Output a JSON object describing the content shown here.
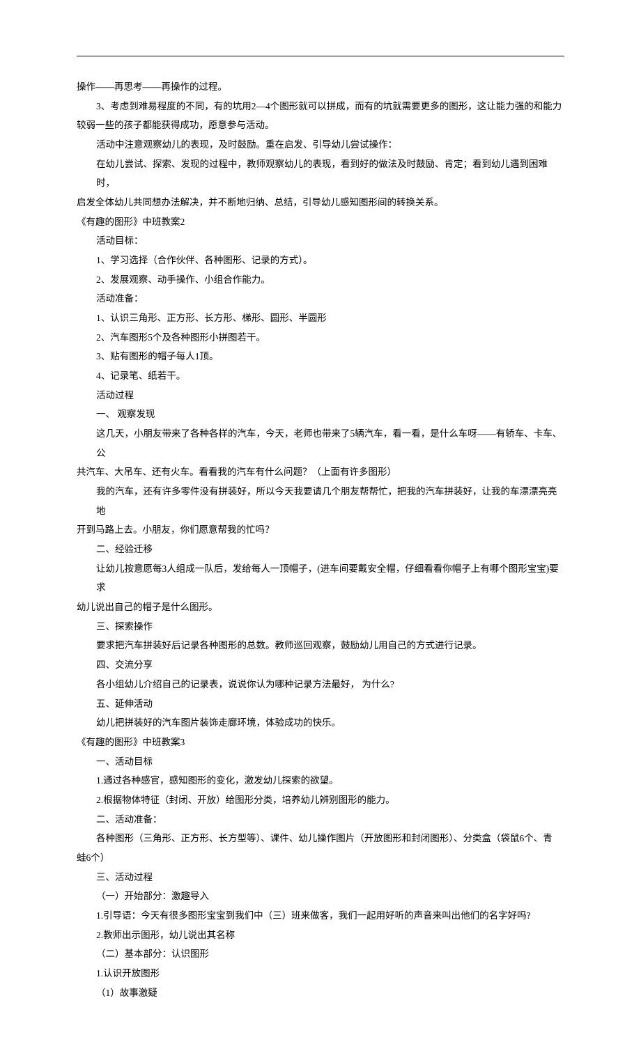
{
  "lines": [
    {
      "cls": "line",
      "text": "操作——再思考——再操作的过程。"
    },
    {
      "cls": "line indent1",
      "text": "3、考虑到难易程度的不同，有的坑用2—4个图形就可以拼成，而有的坑就需要更多的图形，这让能力强的和能力"
    },
    {
      "cls": "line",
      "text": "较弱一些的孩子都能获得成功，愿意参与活动。"
    },
    {
      "cls": "line indent1",
      "text": "活动中注意观察幼儿的表现，及时鼓励。重在启发、引导幼儿尝试操作："
    },
    {
      "cls": "line indent1",
      "text": "在幼儿尝试、探索、发现的过程中，教师观察幼儿的表现，看到好的做法及时鼓励、肯定；看到幼儿遇到困难时，"
    },
    {
      "cls": "line",
      "text": "启发全体幼儿共同想办法解决，并不断地归纳、总结，引导幼儿感知图形间的转换关系。"
    },
    {
      "cls": "line heading",
      "text": "《有趣的图形》中班教案2"
    },
    {
      "cls": "line indent1",
      "text": "活动目标："
    },
    {
      "cls": "line indent1",
      "text": "1、学习选择（合作伙伴、各种图形、记录的方式）。"
    },
    {
      "cls": "line indent1",
      "text": "2、发展观察、动手操作、小组合作能力。"
    },
    {
      "cls": "line indent1",
      "text": "活动准备："
    },
    {
      "cls": "line indent1",
      "text": "1、认识三角形、正方形、长方形、梯形、圆形、半圆形"
    },
    {
      "cls": "line indent1",
      "text": "2、汽车图形5个及各种图形小拼图若干。"
    },
    {
      "cls": "line indent1",
      "text": "3、贴有图形的帽子每人1顶。"
    },
    {
      "cls": "line indent1",
      "text": "4、记录笔、纸若干。"
    },
    {
      "cls": "line indent1",
      "text": "活动过程"
    },
    {
      "cls": "line indent1",
      "text": "一、 观察发现"
    },
    {
      "cls": "line indent1",
      "text": "这几天，小朋友带来了各种各样的汽车，今天，老师也带来了5辆汽车，看一看，是什么车呀——有轿车、卡车、公"
    },
    {
      "cls": "line",
      "text": "共汽车、大吊车、还有火车。看看我的汽车有什么问题？（上面有许多图形）"
    },
    {
      "cls": "line indent1",
      "text": "我的汽车，还有许多零件没有拼装好，所以今天我要请几个朋友帮帮忙，把我的汽车拼装好，让我的车漂漂亮亮地"
    },
    {
      "cls": "line",
      "text": "开到马路上去。小朋友，你们愿意帮我的忙吗？"
    },
    {
      "cls": "line indent1",
      "text": "二、经验迁移"
    },
    {
      "cls": "line indent1",
      "text": "让幼儿按意愿每3人组成一队后，发给每人一顶帽子，(进车间要戴安全帽，仔细看看你帽子上有哪个图形宝宝)要求"
    },
    {
      "cls": "line",
      "text": "幼儿说出自己的帽子是什么图形。"
    },
    {
      "cls": "line indent1",
      "text": "三、探索操作"
    },
    {
      "cls": "line indent1",
      "text": "要求把汽车拼装好后记录各种图形的总数。教师巡回观察，鼓励幼儿用自己的方式进行记录。"
    },
    {
      "cls": "line indent1",
      "text": "四、交流分享"
    },
    {
      "cls": "line indent1",
      "text": "各小组幼儿介绍自己的记录表，说说你认为哪种记录方法最好， 为什么?"
    },
    {
      "cls": "line indent1",
      "text": "五、延伸活动"
    },
    {
      "cls": "line indent1",
      "text": "幼儿把拼装好的汽车图片装饰走廊环境，体验成功的快乐。"
    },
    {
      "cls": "line heading",
      "text": "《有趣的图形》中班教案3"
    },
    {
      "cls": "line indent1",
      "text": "一、活动目标"
    },
    {
      "cls": "line indent1",
      "text": "1.通过各种感官，感知图形的变化，激发幼儿探索的欲望。"
    },
    {
      "cls": "line indent1",
      "text": "2.根据物体特征（封闭、开放）给图形分类，培养幼儿辨别图形的能力。"
    },
    {
      "cls": "line indent1",
      "text": "二、活动准备："
    },
    {
      "cls": "line indent1",
      "text": "各种图形（三角形、正方形、长方型等）、课件、幼儿操作图片（开放图形和封闭图形）、分类盒（袋鼠6个、青"
    },
    {
      "cls": "line",
      "text": "蛙6个）"
    },
    {
      "cls": "line indent1",
      "text": "三、活动过程"
    },
    {
      "cls": "line indent1",
      "text": "（一）开始部分：激趣导入"
    },
    {
      "cls": "line indent1",
      "text": "1.引导语：今天有很多图形宝宝到我们中（三）班来做客，我们一起用好听的声音来叫出他们的名字好吗?"
    },
    {
      "cls": "line indent1",
      "text": "2.教师出示图形，幼儿说出其名称"
    },
    {
      "cls": "line indent1",
      "text": "（二）基本部分：认识图形"
    },
    {
      "cls": "line indent1",
      "text": "1.认识开放图形"
    },
    {
      "cls": "line indent1",
      "text": "（1）故事激疑"
    }
  ]
}
